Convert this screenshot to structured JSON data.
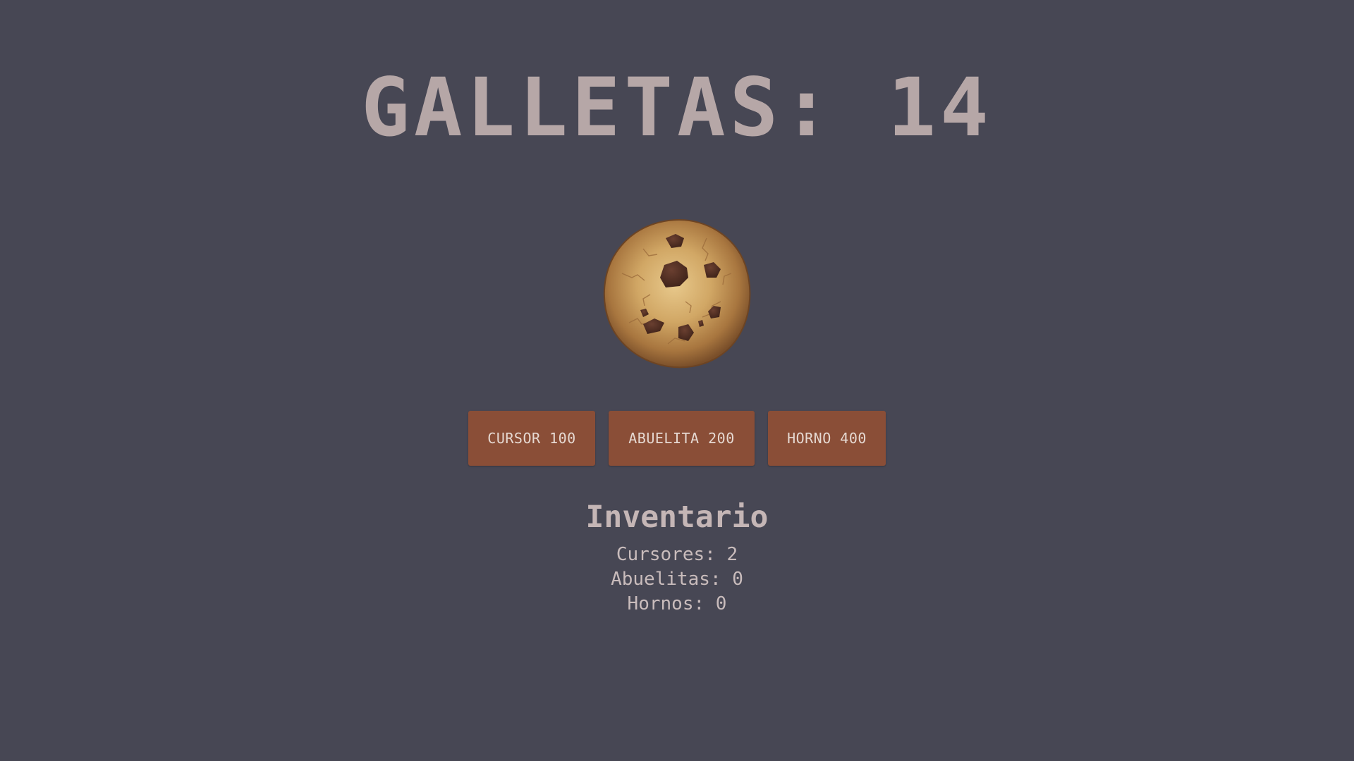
{
  "counter": {
    "text": "GALLETAS: 14"
  },
  "cookie": {
    "icon": "cookie-icon"
  },
  "shop": {
    "cursor_label": "CURSOR 100",
    "abuelita_label": "ABUELITA 200",
    "horno_label": "HORNO 400"
  },
  "inventory": {
    "title": "Inventario",
    "cursores": "Cursores: 2",
    "abuelitas": "Abuelitas: 0",
    "hornos": "Hornos: 0"
  },
  "colors": {
    "background": "#474754",
    "button": "#8a4e37",
    "text": "#b6a7a7"
  }
}
